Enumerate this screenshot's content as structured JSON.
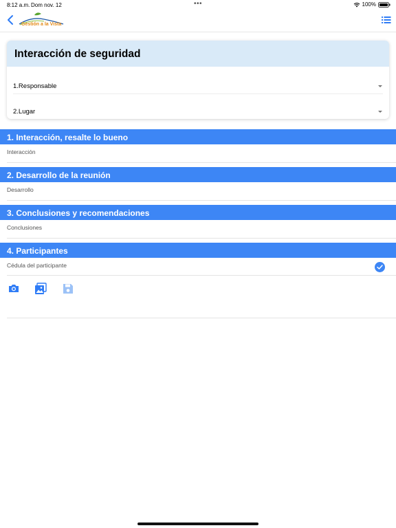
{
  "status_bar": {
    "time": "8:12 a.m.",
    "date": "Dom nov. 12",
    "dots": "•••",
    "battery": "100%"
  },
  "nav": {
    "logo_text": "Gestión a la Vista",
    "back_icon": "chevron-left-icon",
    "menu_icon": "list-icon"
  },
  "card": {
    "title": "Interacción de seguridad",
    "selects": [
      {
        "label": "1.Responsable"
      },
      {
        "label": "2.Lugar"
      }
    ]
  },
  "sections": [
    {
      "title": "1. Interacción, resalte lo bueno",
      "placeholder": "Interacción"
    },
    {
      "title": "2. Desarrollo de la reunión",
      "placeholder": "Desarrollo"
    },
    {
      "title": "3. Conclusiones y recomendaciones",
      "placeholder": "Conclusiones"
    },
    {
      "title": "4. Participantes",
      "placeholder": "Cédula del participante"
    }
  ],
  "actions": [
    {
      "icon": "camera-icon"
    },
    {
      "icon": "gallery-icon"
    },
    {
      "icon": "save-icon"
    }
  ],
  "colors": {
    "accent": "#3d86f5",
    "card_header": "#d9eaf8"
  }
}
